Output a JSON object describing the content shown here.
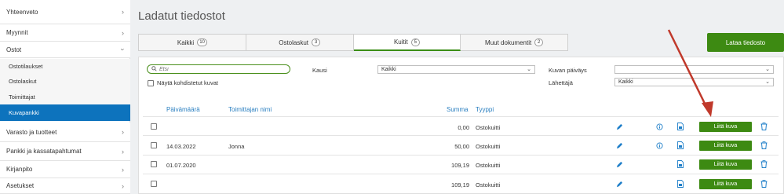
{
  "sidebar": {
    "items": [
      {
        "label": "Yhteenveto"
      },
      {
        "label": "Myynnit"
      },
      {
        "label": "Ostot"
      },
      {
        "label": "Varasto ja tuotteet"
      },
      {
        "label": "Pankki ja kassatapahtumat"
      },
      {
        "label": "Kirjanpito"
      },
      {
        "label": "Asetukset"
      }
    ],
    "ostot_sub": [
      {
        "label": "Ostotilaukset"
      },
      {
        "label": "Ostolaskut"
      },
      {
        "label": "Toimittajat"
      },
      {
        "label": "Kuvapankki"
      }
    ]
  },
  "page": {
    "title": "Ladatut tiedostot"
  },
  "tabs": [
    {
      "label": "Kaikki",
      "count": "10"
    },
    {
      "label": "Ostolaskut",
      "count": "3"
    },
    {
      "label": "Kuitit",
      "count": "5"
    },
    {
      "label": "Muut dokumentit",
      "count": "2"
    }
  ],
  "upload_button": "Lataa tiedosto",
  "filters": {
    "search_placeholder": "Etsi",
    "show_allocated_label": "Näytä kohdistetut kuvat",
    "season_label": "Kausi",
    "season_value": "Kaikki",
    "image_date_label": "Kuvan päiväys",
    "image_date_value": "",
    "sender_label": "Lähettäjä",
    "sender_value": "Kaikki"
  },
  "table": {
    "headers": {
      "date": "Päivämäärä",
      "supplier": "Toimittajan nimi",
      "amount": "Summa",
      "type": "Tyyppi"
    },
    "rows": [
      {
        "date": "",
        "supplier": "",
        "amount": "0,00",
        "type": "Ostokuitti"
      },
      {
        "date": "14.03.2022",
        "supplier": "Jonna",
        "amount": "50,00",
        "type": "Ostokuitti"
      },
      {
        "date": "01.07.2020",
        "supplier": "",
        "amount": "109,19",
        "type": "Ostokuitti"
      },
      {
        "date": "",
        "supplier": "",
        "amount": "109,19",
        "type": "Ostokuitti"
      }
    ],
    "attach_label": "Liitä kuva"
  },
  "colors": {
    "accent_green": "#3d8a12",
    "link_blue": "#2a7fc0",
    "active_blue": "#0d73bd",
    "arrow_red": "#c0392b"
  }
}
